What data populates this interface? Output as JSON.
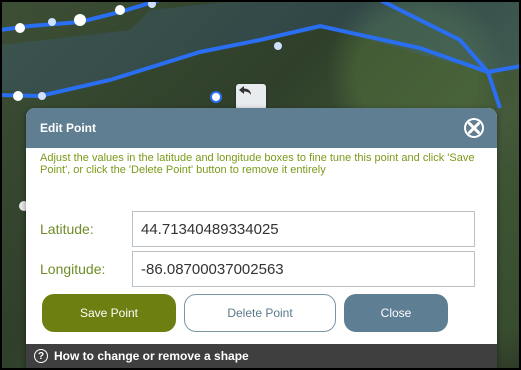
{
  "map": {
    "line_color": "#2a6ef2",
    "vertex_color": "#ffffff"
  },
  "undo": {
    "icon": "undo-icon"
  },
  "dialog": {
    "title": "Edit Point",
    "instructions": "Adjust the values in the latitude and longitude boxes to fine tune this point and click 'Save Point', or click the 'Delete Point' button to remove it entirely",
    "latitude_label": "Latitude:",
    "latitude_value": "44.71340489334025",
    "longitude_label": "Longitude:",
    "longitude_value": "-86.08700037002563",
    "save_label": "Save Point",
    "delete_label": "Delete Point",
    "close_label": "Close",
    "close_icon": "close-icon"
  },
  "footer": {
    "help_text": "How to change or remove a shape",
    "help_icon": "question-circle-icon"
  },
  "colors": {
    "header": "#607e91",
    "instruction_text": "#7a9a1a",
    "save_button": "#6d7f10",
    "close_button": "#5d7e93",
    "footer": "#3f3f3f"
  }
}
